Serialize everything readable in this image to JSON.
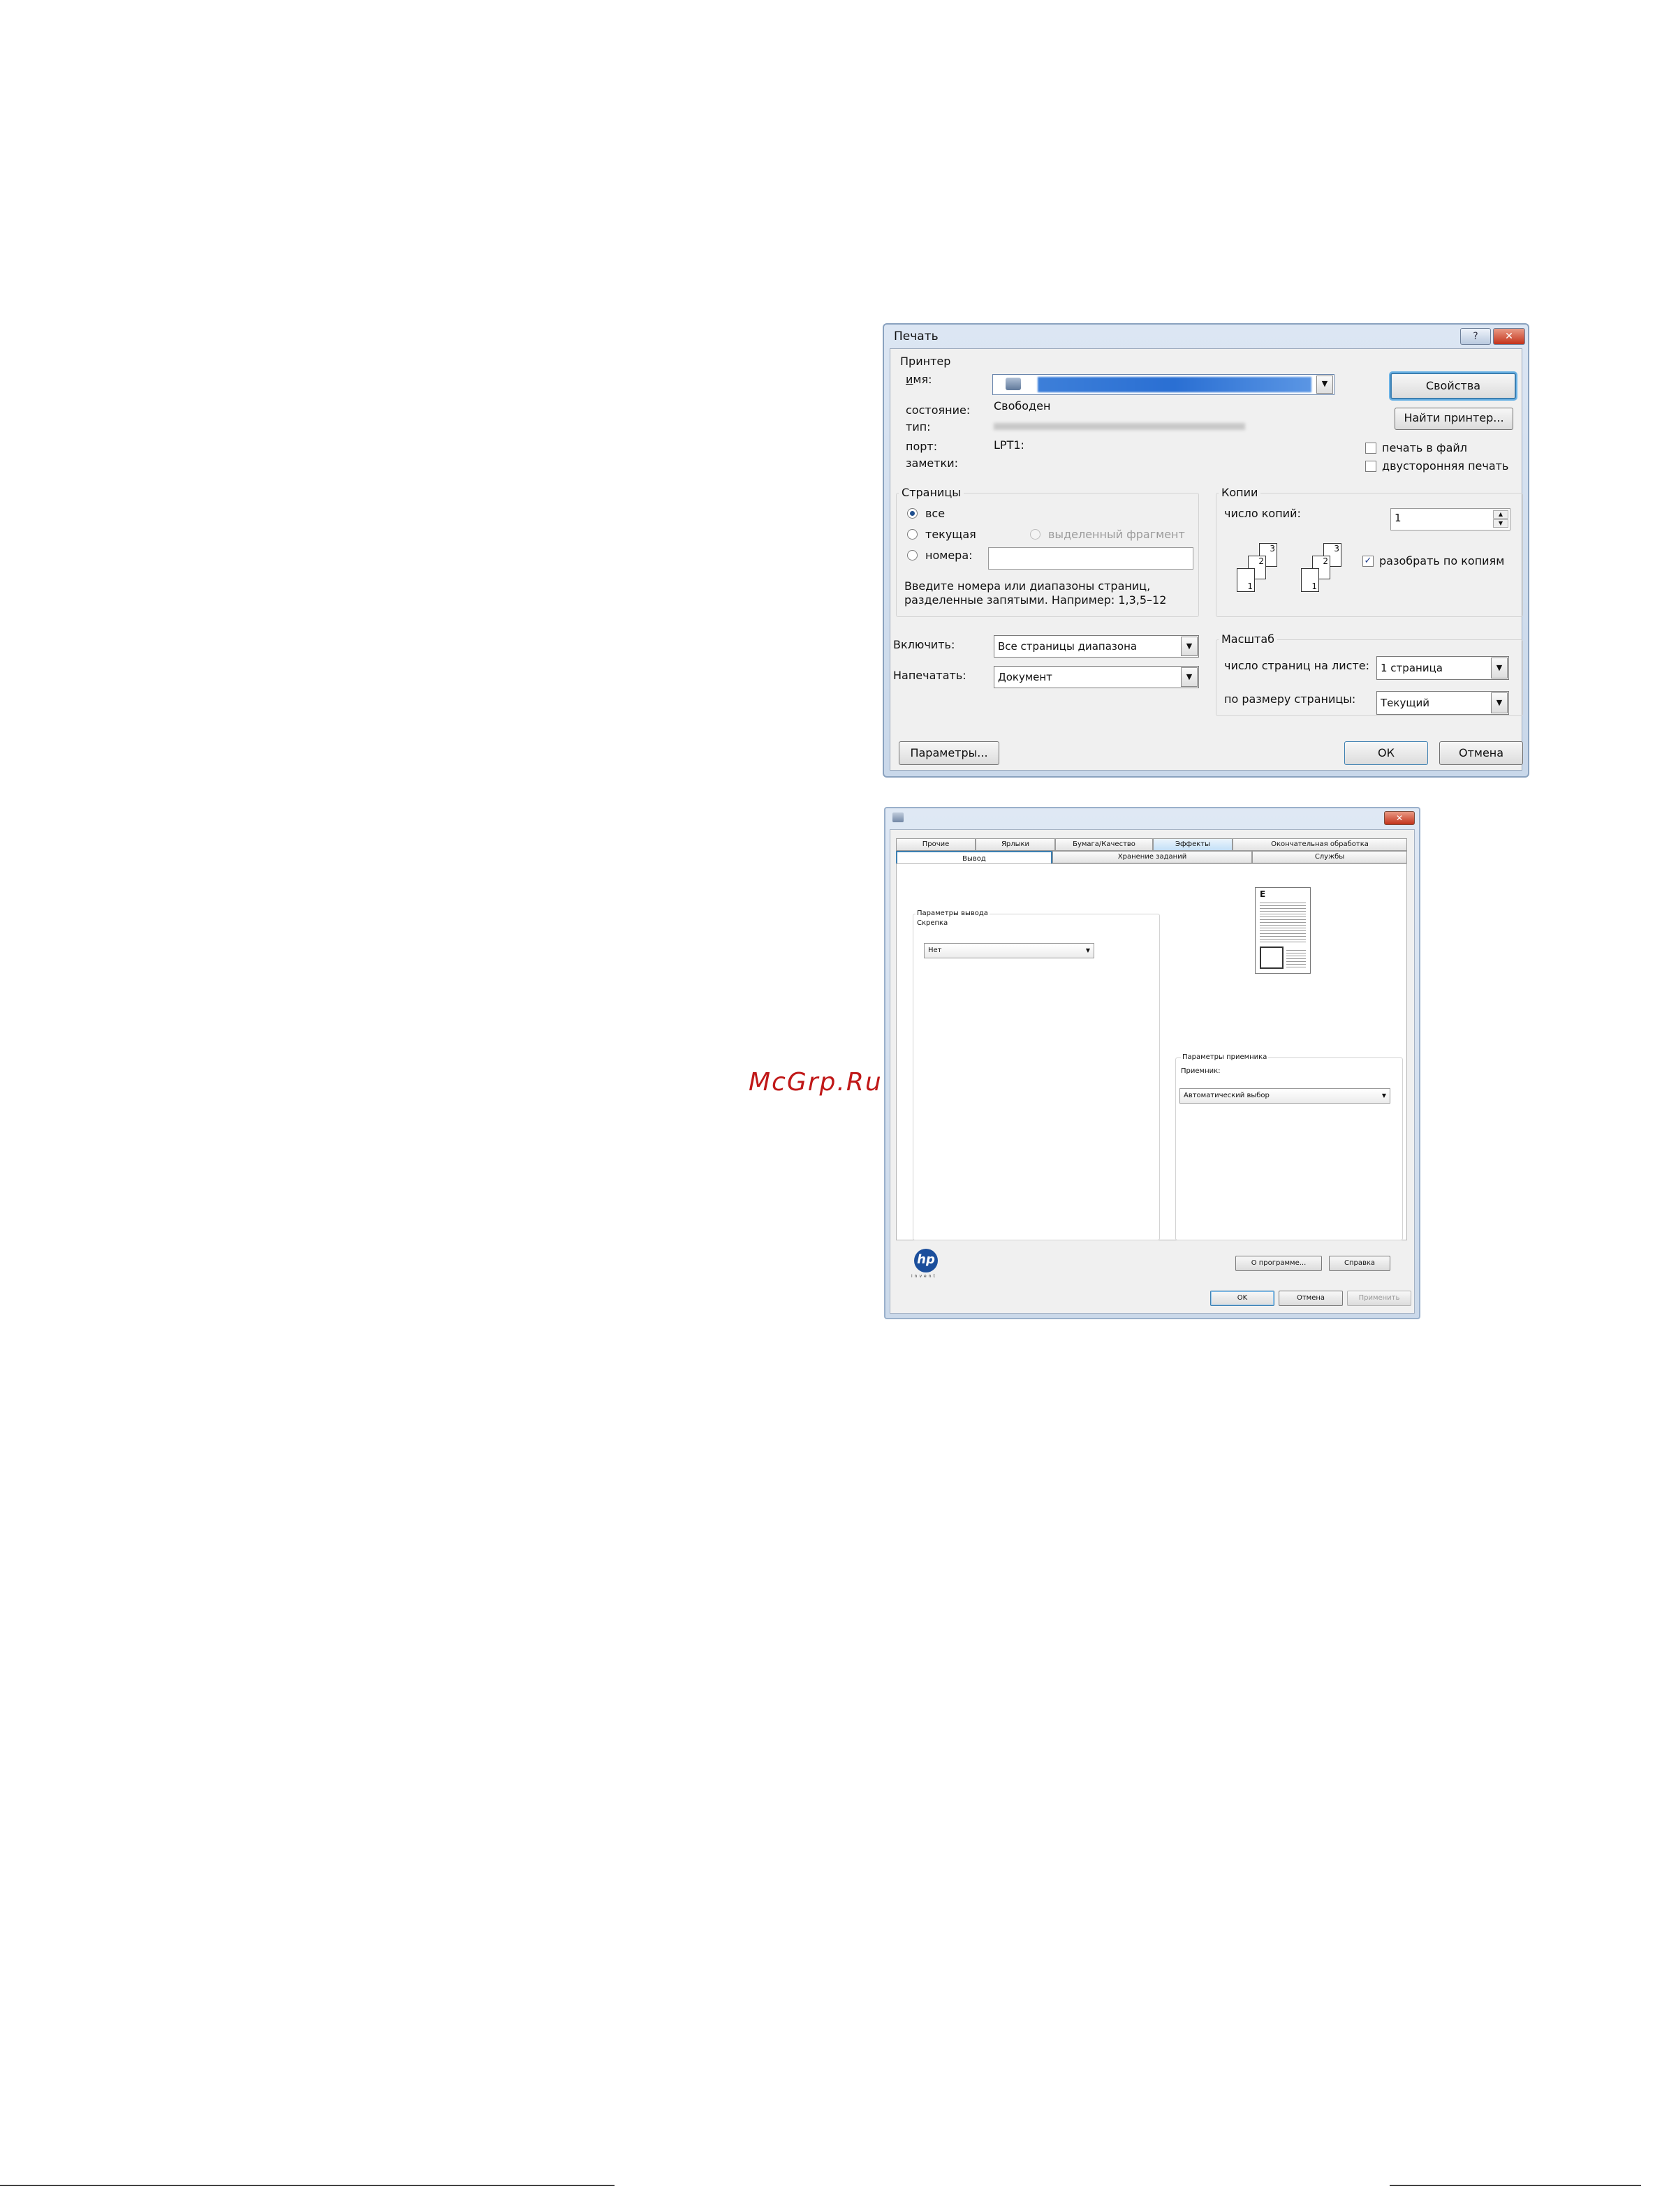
{
  "watermark": "McGrp.Ru",
  "print_dialog": {
    "title": "Печать",
    "help_btn": "?",
    "close_btn": "✕",
    "printer_group": "Принтер",
    "name_label": "имя:",
    "status_label": "состояние:",
    "status_value": "Свободен",
    "type_label": "тип:",
    "port_label": "порт:",
    "port_value": "LPT1:",
    "notes_label": "заметки:",
    "properties_btn": "Свойства",
    "find_printer_btn": "Найти принтер...",
    "print_to_file": "печать в файл",
    "duplex": "двусторонняя печать",
    "pages_group": "Страницы",
    "pages_all": "все",
    "pages_current": "текущая",
    "pages_selection": "выделенный фрагмент",
    "pages_numbers": "номера:",
    "pages_hint_1": "Введите номера или диапазоны страниц,",
    "pages_hint_2": "разделенные запятыми. Например: 1,3,5–12",
    "copies_group": "Копии",
    "copies_label": "число копий:",
    "copies_value": "1",
    "collate": "разобрать по копиям",
    "collate_pages": [
      "3",
      "2",
      "1",
      "3",
      "2",
      "1"
    ],
    "include_label": "Включить:",
    "include_value": "Все страницы диапазона",
    "print_what_label": "Напечатать:",
    "print_what_value": "Документ",
    "scale_group": "Масштаб",
    "pages_per_sheet_label": "число страниц на листе:",
    "pages_per_sheet_value": "1 страница",
    "fit_to_label": "по размеру страницы:",
    "fit_to_value": "Текущий",
    "options_btn": "Параметры...",
    "ok_btn": "ОК",
    "cancel_btn": "Отмена"
  },
  "props_dialog": {
    "close_btn": "✕",
    "tabs_row1": [
      "Прочие",
      "Ярлыки",
      "Бумага/Качество",
      "Эффекты",
      "Окончательная обработка"
    ],
    "tabs_row2": [
      "Вывод",
      "Хранение заданий",
      "Службы"
    ],
    "output_group": "Параметры вывода",
    "staple_label": "Скрепка",
    "staple_value": "Нет",
    "dest_group": "Параметры приемника",
    "dest_label": "Приемник:",
    "dest_value": "Автоматический выбор",
    "preview_letter": "E",
    "logo": "hp",
    "logo_sub": "invent",
    "about_btn": "О программе...",
    "help_btn": "Справка",
    "ok_btn": "OK",
    "cancel_btn": "Отмена",
    "apply_btn": "Применить"
  },
  "colors": {
    "accent": "#3c7fb1",
    "selection": "#2a6fd3",
    "watermark": "#c01818"
  }
}
